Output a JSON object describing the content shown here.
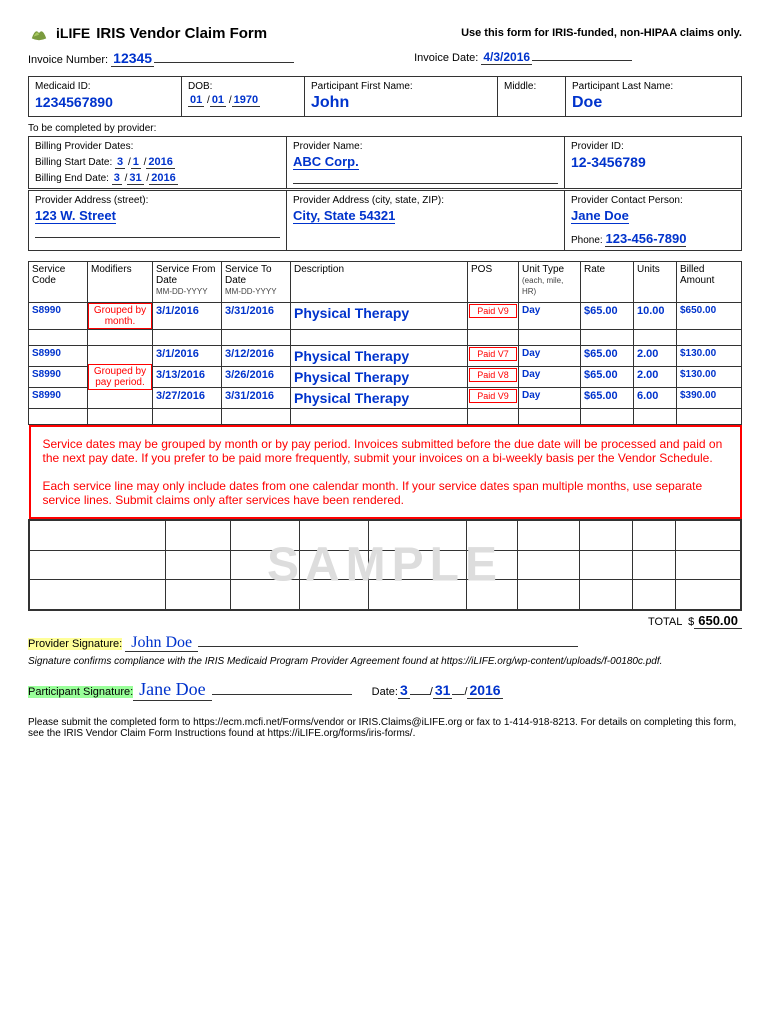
{
  "header": {
    "brand": "iLIFE",
    "title": "IRIS Vendor Claim Form",
    "note": "Use this form for IRIS-funded, non-HIPAA claims only."
  },
  "invoice": {
    "num_lbl": "Invoice Number:",
    "num": "12345",
    "date_lbl": "Invoice Date:",
    "date": "4/3/2016"
  },
  "participant": {
    "medicaid_lbl": "Medicaid ID:",
    "medicaid": "1234567890",
    "dob_lbl": "DOB:",
    "dob_m": "01",
    "dob_d": "01",
    "dob_y": "1970",
    "first_lbl": "Participant First Name:",
    "first": "John",
    "mid_lbl": "Middle:",
    "mid": "",
    "last_lbl": "Participant Last Name:",
    "last": "Doe"
  },
  "provider_section": "To be completed by provider:",
  "provider": {
    "dates_lbl": "Billing Provider Dates:",
    "start_lbl": "Billing Start Date:",
    "start_m": "3",
    "start_d": "1",
    "start_y": "2016",
    "end_lbl": "Billing End Date:",
    "end_m": "3",
    "end_d": "31",
    "end_y": "2016",
    "name_lbl": "Provider Name:",
    "name": "ABC Corp.",
    "id_lbl": "Provider ID:",
    "id": "12-3456789",
    "addr_st_lbl": "Provider Address (street):",
    "addr_st": "123 W. Street",
    "addr_csz_lbl": "Provider Address (city, state, ZIP):",
    "addr_csz": "City, State 54321",
    "contact_lbl": "Provider Contact Person:",
    "contact": "Jane Doe",
    "phone_lbl": "Phone:",
    "phone": "123-456-7890"
  },
  "svc_headers": {
    "code": "Service Code",
    "mod": "Modifiers",
    "from": "Service From Date",
    "to": "Service To Date",
    "desc": "Description",
    "pos": "POS",
    "unit": "Unit Type",
    "unit_sub": "(each, mile, HR)",
    "rate": "Rate",
    "units": "Units",
    "billed": "Billed Amount",
    "datefmt": "MM-DD-YYYY"
  },
  "svc_rows": [
    {
      "code": "S8990",
      "mod": "Grouped by month.",
      "from": "3/1/2016",
      "to": "3/31/2016",
      "desc": "Physical Therapy",
      "pos": "Paid V9",
      "unit": "Day",
      "rate": "$65.00",
      "units": "10.00",
      "billed": "$650.00"
    },
    {
      "code": "S8990",
      "mod": "Grouped by pay period.",
      "from": "3/1/2016",
      "to": "3/12/2016",
      "desc": "Physical Therapy",
      "pos": "Paid V7",
      "unit": "Day",
      "rate": "$65.00",
      "units": "2.00",
      "billed": "$130.00"
    },
    {
      "code": "S8990",
      "mod": "",
      "from": "3/13/2016",
      "to": "3/26/2016",
      "desc": "Physical Therapy",
      "pos": "Paid V8",
      "unit": "Day",
      "rate": "$65.00",
      "units": "2.00",
      "billed": "$130.00"
    },
    {
      "code": "S8990",
      "mod": "",
      "from": "3/27/2016",
      "to": "3/31/2016",
      "desc": "Physical Therapy",
      "pos": "Paid V9",
      "unit": "Day",
      "rate": "$65.00",
      "units": "6.00",
      "billed": "$390.00"
    }
  ],
  "note": {
    "p1": "Service dates may be grouped by month or by pay period. Invoices submitted before the due date will be processed and paid on the next pay date. If you prefer to be paid more frequently, submit your invoices on a bi-weekly basis per the Vendor Schedule.",
    "p2": "Each service line may only include dates from one calendar month. If your service dates span multiple months, use separate service lines. Submit claims only after services have been rendered."
  },
  "sample": "SAMPLE",
  "total": {
    "lbl": "TOTAL",
    "cur": "$",
    "val": "650.00"
  },
  "sig": {
    "prov_lbl": "Provider Signature:",
    "prov": "John Doe",
    "compliance": "Signature confirms compliance with the IRIS Medicaid Program Provider Agreement found at https://iLIFE.org/wp-content/uploads/f-00180c.pdf.",
    "part_lbl": "Participant Signature:",
    "part": "Jane Doe",
    "date_lbl": "Date:",
    "d_m": "3",
    "d_d": "31",
    "d_y": "2016"
  },
  "footer": "Please submit the completed form to https://ecm.mcfi.net/Forms/vendor or IRIS.Claims@iLIFE.org or fax to 1-414-918-8213. For details on completing this form, see the IRIS Vendor Claim Form Instructions found at https://iLIFE.org/forms/iris-forms/."
}
